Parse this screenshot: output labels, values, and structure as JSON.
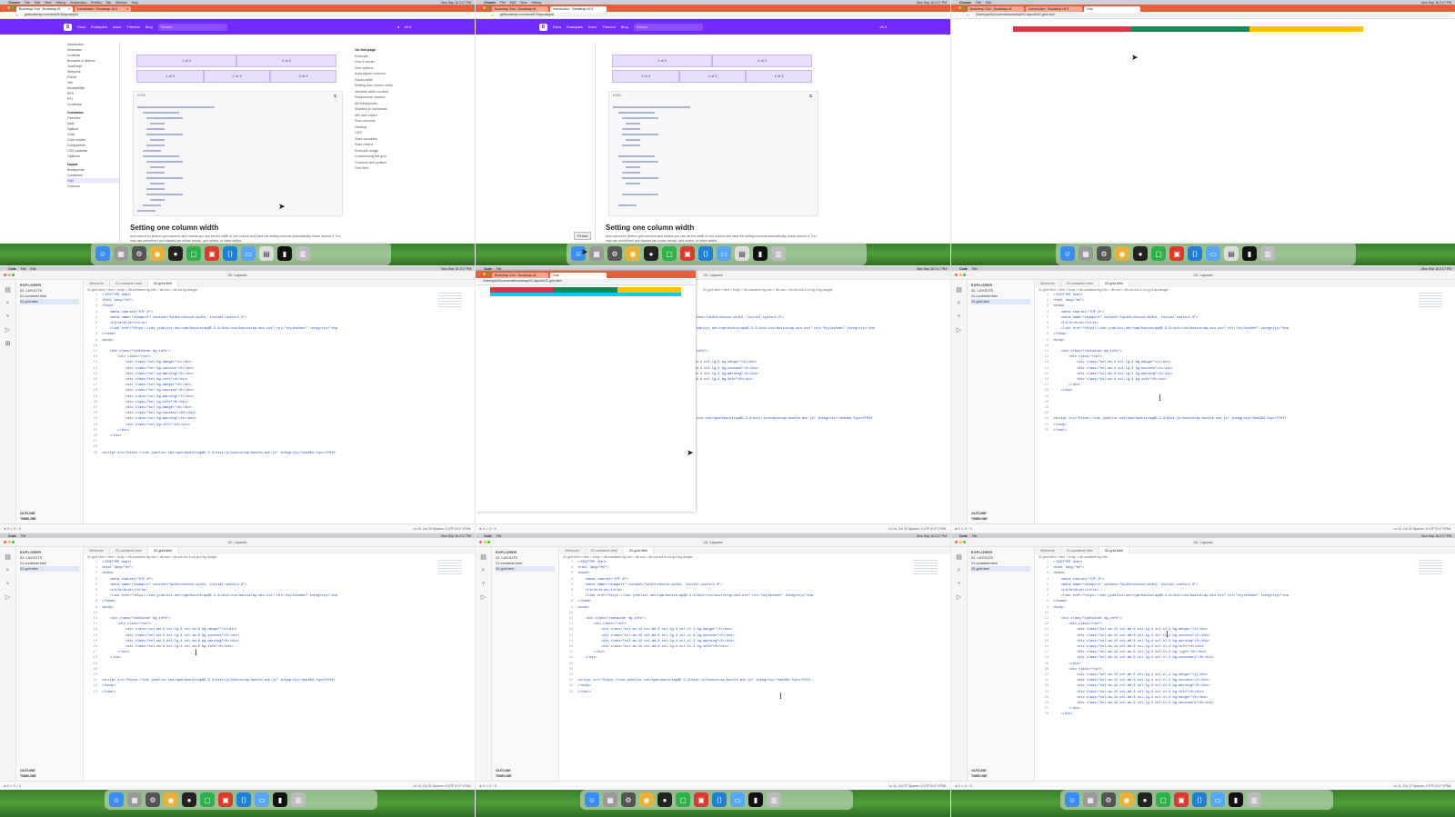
{
  "menubar": {
    "app": "Chrome",
    "items": [
      "File",
      "Edit",
      "View",
      "History",
      "Bookmarks",
      "Profiles",
      "Tab",
      "Window",
      "Help"
    ],
    "time": "Mon Sep 16 2:17 PM"
  },
  "browser": {
    "tab1": "Bootstrap Grid · Bootstrap v5",
    "tab2": "Introduction · Bootstrap v5.3",
    "tab3": "Grid",
    "url": "getbootstrap.com/docs/5.3/layout/grid/",
    "file_url": "/Users/joe/Documents/bootstrap/02-layouts/02-grid.html"
  },
  "bsnav": {
    "logo": "B",
    "links": [
      "Docs",
      "Examples",
      "Icons",
      "Themes",
      "Blog"
    ],
    "search": "Search",
    "version": "v5.3"
  },
  "docs_sidebar": {
    "items_top": [
      "Introduction",
      "Download",
      "Contents",
      "Browsers & devices",
      "JavaScript",
      "Webpack",
      "Parcel",
      "Vite",
      "Accessibility",
      "RFS",
      "RTL",
      "Contribute"
    ],
    "customize": "Customize",
    "customize_items": [
      "Overview",
      "Sass",
      "Options",
      "Color",
      "Color modes",
      "Components",
      "CSS variables",
      "Optimize"
    ],
    "layout": "Layout",
    "layout_items": [
      "Breakpoints",
      "Containers",
      "Grid",
      "Columns",
      "Gutters"
    ]
  },
  "grid_examples": {
    "row1": [
      "1 of 2",
      "2 of 2"
    ],
    "row2": [
      "1 of 3",
      "2 of 3",
      "3 of 3"
    ],
    "code_label": "HTML"
  },
  "toc": {
    "heading": "On this page",
    "items": [
      "Example",
      "How it works",
      "Grid options",
      "Auto-layout columns",
      "Equal-width",
      "Setting one column width",
      "Variable width content",
      "Responsive classes",
      "All breakpoints",
      "Stacked to horizontal",
      "Mix and match",
      "Row columns",
      "Nesting",
      "CSS",
      "Sass variables",
      "Sass mixins",
      "Example usage",
      "Customizing the grid",
      "Columns and gutters",
      "Grid tiers"
    ]
  },
  "section": {
    "title": "Setting one column width",
    "body": "Auto-layout for flexbox grid columns also means you can set the width of one column and have the sibling columns automatically resize around it. You may use predefined grid classes (as shown below), grid mixins, or inline widths."
  },
  "tooltip": "Finder",
  "ide": {
    "window_title": "02- Layouts",
    "explorer_heading": "EXPLORER",
    "folder": "02- LAYOUTS",
    "files": [
      "01-container.html",
      "02-grid.html"
    ],
    "outline": "OUTLINE",
    "timeline": "TIMELINE",
    "tab_welcome": "Welcome",
    "tab_container": "01-container.html",
    "tab_grid": "02-grid.html",
    "crumb_a": "02-grid.html > html > body > div.container.bg-info > div.row > div.col.bg-danger",
    "crumb_b": "02-grid.html > html > body > div.container.bg-info > div.row > div.col-md-4.col-lg-4.bg-danger",
    "crumb_c": "02-grid.html > html > body > div.container.bg-info",
    "status_left": "⊗ 0 ⚠ 0   ⑂ 0",
    "status_a": "Ln 13, Col 24   Spaces: 4   UTF-8   LF   HTML",
    "status_b": "Ln 14, Col 31   Spaces: 4   UTF-8   LF   HTML",
    "status_c": "Ln 11, Col 37   Spaces: 4   UTF-8   LF   HTML"
  },
  "code_head": [
    "<!DOCTYPE html>",
    "<html lang=\"en\">",
    "<head>",
    "    <meta charset=\"UTF-8\">",
    "    <meta name=\"viewport\" content=\"width=device-width, initial-scale=1.0\">",
    "    <title>Grid</title>",
    "    <link href=\"https://cdn.jsdelivr.net/npm/bootstrap@5.3.3/dist/css/bootstrap.min.css\" rel=\"stylesheet\" integrity=\"sha",
    "</head>",
    "<body>",
    ""
  ],
  "code_a": [
    "    <div class=\"container bg-info\">",
    "        <div class=\"row\">",
    "            <div class=\"col bg-danger\">1</div>",
    "            <div class=\"col bg-success\">2</div>",
    "            <div class=\"col bg-warning\">3</div>",
    "            <div class=\"col bg-info\">4</div>",
    "            <div class=\"col bg-danger\">5</div>",
    "            <div class=\"col bg-success\">6</div>",
    "            <div class=\"col bg-warning\">7</div>",
    "            <div class=\"col bg-info\">8</div>",
    "            <div class=\"col bg-danger\">9</div>",
    "            <div class=\"col bg-success\">10</div>",
    "            <div class=\"col bg-warning\">11</div>",
    "            <div class=\"col bg-info\">12</div>",
    "        </div>",
    "    </div>",
    "",
    "",
    "<script src=\"https://cdn.jsdelivr.net/npm/bootstrap@5.3.3/dist/js/bootstrap.bundle.min.js\" integrity=\"sha384-YvpcrYf0tY"
  ],
  "code_b": [
    "    <div class=\"container bg-info\">",
    "        <div class=\"row\">",
    "            <div class=\"col-md-4 col-lg-4 bg-danger\">1</div>",
    "            <div class=\"col-md-4 col-lg-4 bg-success\">2</div>",
    "            <div class=\"col-md-4 col-lg-4 bg-warning\">3</div>",
    "            <div class=\"col-md-4 col-lg-4 bg-info\">4</div>",
    "        </div>",
    "    </div>",
    "",
    "",
    "",
    "",
    "<script src=\"https://cdn.jsdelivr.net/npm/bootstrap@5.3.3/dist/js/bootstrap.bundle.min.js\" integrity=\"sha384-YvpcrYf0tY",
    "</body>",
    "</html>"
  ],
  "code_c": [
    "    <div class=\"container bg-info\">",
    "        <div class=\"row\">",
    "            <div class=\"col-md-3 col-lg-4 col-sm-6 bg-danger\">1</div>",
    "            <div class=\"col-md-3 col-lg-4 col-sm-6 bg-success\">2</div>",
    "            <div class=\"col-md-3 col-lg-4 col-sm-6 bg-warning\">3</div>",
    "            <div class=\"col-md-3 col-lg-4 col-sm-6 bg-info\">4</div>",
    "        </div>",
    "    </div>",
    "",
    "",
    "",
    "<script src=\"https://cdn.jsdelivr.net/npm/bootstrap@5.3.3/dist/js/bootstrap.bundle.min.js\" integrity=\"sha384-YvpcrYf0tY",
    "</body>",
    "</html>"
  ],
  "code_d": [
    "    <div class=\"container bg-info\">",
    "        <div class=\"row\">",
    "            <div class=\"col-sm-12 col-md-6 col-lg-4 col-xl-3 bg-danger\">1</div>",
    "            <div class=\"col-sm-12 col-md-6 col-lg-4 col-xl-3 bg-success\">2</div>",
    "            <div class=\"col-sm-12 col-md-6 col-lg-4 col-xl-3 bg-warning\">3</div>",
    "            <div class=\"col-sm-12 col-md-6 col-lg-4 col-xl-3 bg-info\">4</div>",
    "        </div>",
    "    </div>",
    "",
    "",
    "",
    "<script src=\"https://cdn.jsdelivr.net/npm/bootstrap@5.3.3/dist/js/bootstrap.bundle.min.js\" integrity=\"sha384-YvpcrYf0tY",
    "</body>",
    "</html>"
  ],
  "code_e": [
    "    <div class=\"container bg-info\">",
    "        <div class=\"row\">",
    "            <div class=\"col-sm-12 col-md-6 col-lg-4 col-xl-2 bg-danger\">1</div>",
    "            <div class=\"col-sm-12 col-md-6 col-lg-4 col-xl-2 bg-success\">2</div>",
    "            <div class=\"col-sm-12 col-md-6 col-lg-4 col-xl-2 bg-warning\">3</div>",
    "            <div class=\"col-sm-12 col-md-6 col-lg-4 col-xl-2 bg-info\">4</div>",
    "            <div class=\"col-sm-12 col-md-6 col-lg-4 col-xl-2 bg-light\">5</div>",
    "            <div class=\"col-sm-12 col-md-6 col-lg-4 col-xl-2 bg-secondary\">6</div>",
    "        </div>",
    "        <div class=\"row\">",
    "            <div class=\"col-sm-12 col-md-6 col-lg-4 col-xl-2 bg-danger\">1</div>",
    "            <div class=\"col-sm-12 col-md-6 col-lg-4 col-xl-2 bg-success\">2</div>",
    "            <div class=\"col-sm-12 col-md-6 col-lg-4 col-xl-2 bg-warning\">3</div>",
    "            <div class=\"col-sm-12 col-md-6 col-lg-4 col-xl-2 bg-info\">4</div>",
    "            <div class=\"col-sm-12 col-md-6 col-lg-4 col-xl-2 bg-danger\">5</div>",
    "            <div class=\"col-sm-12 col-md-6 col-lg-4 col-xl-2 bg-secondary\">6</div>",
    "        </div>",
    "    </div>"
  ],
  "dock_icons": [
    "finder-icon",
    "launchpad-icon",
    "settings-icon",
    "chrome-icon",
    "github-icon",
    "messages-icon",
    "office-icon",
    "vscode-icon",
    "folder-icon",
    "preview-icon",
    "terminal-icon",
    "trash-icon"
  ],
  "colors": {
    "bootstrap_purple": "#712cf9",
    "tab_orange": "#e0613a",
    "bg_danger": "#dc3545",
    "bg_success": "#198754",
    "bg_warning": "#ffc107",
    "bg_info": "#0dcaf0"
  }
}
